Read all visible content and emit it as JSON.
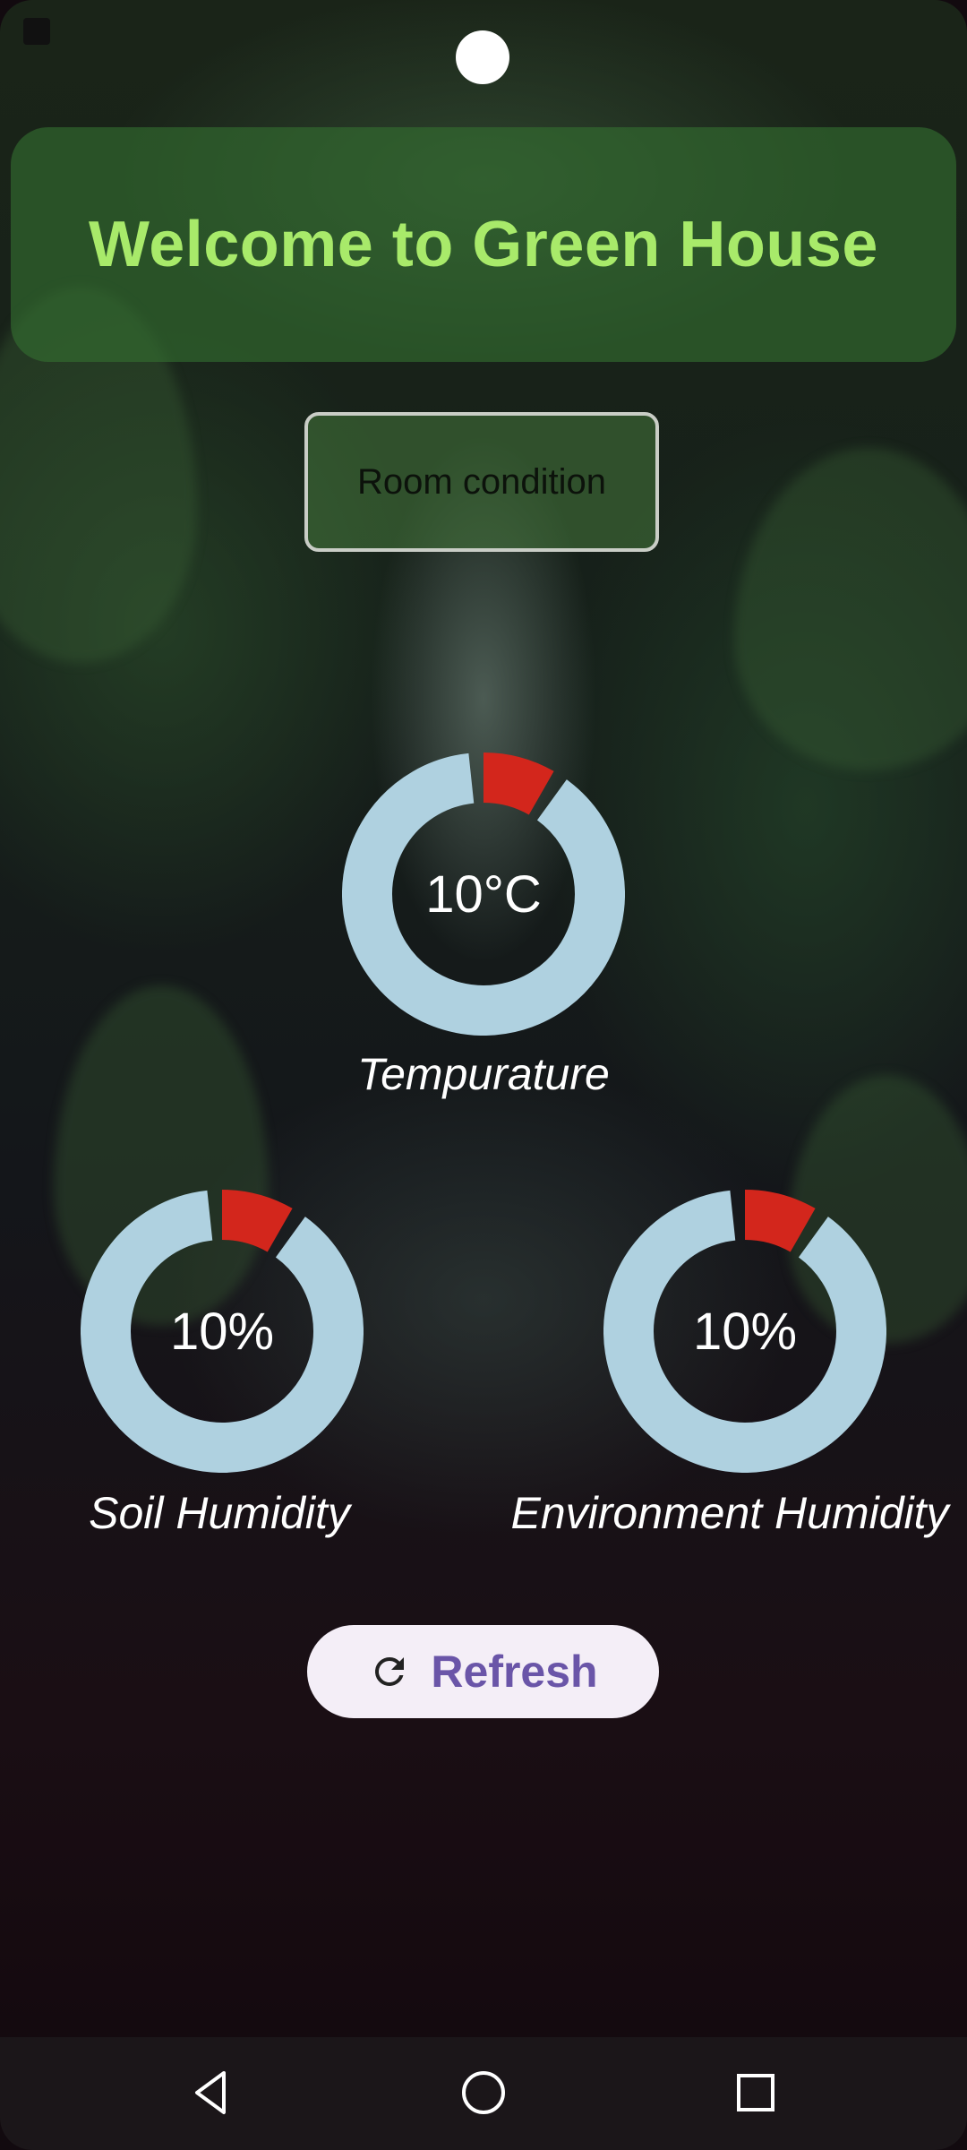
{
  "header": {
    "title": "Welcome to Green House"
  },
  "room_button": {
    "label": "Room condition"
  },
  "gauges": [
    {
      "value": "10°C",
      "label": "Tempurature",
      "level_percent": 10
    },
    {
      "value": "10%",
      "label": "Soil Humidity",
      "level_percent": 10
    },
    {
      "value": "10%",
      "label": "Environment Humidity",
      "level_percent": 10
    }
  ],
  "refresh_button": {
    "label": "Refresh",
    "icon": "refresh-icon"
  },
  "nav": {
    "back_icon": "back-triangle-icon",
    "home_icon": "home-circle-icon",
    "recents_icon": "recents-square-icon"
  },
  "colors": {
    "title_text": "#a8ea6a",
    "card_bg": "#347030",
    "gauge_track": "#afd1e0",
    "gauge_indicator": "#d3261c",
    "refresh_bg": "#f4eef7",
    "refresh_text": "#6a55a8"
  }
}
